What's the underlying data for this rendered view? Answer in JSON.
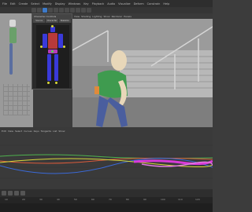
{
  "app": {
    "menu": [
      "File",
      "Edit",
      "Create",
      "Select",
      "Modify",
      "Display",
      "Windows",
      "Key",
      "Playback",
      "Audio",
      "Visualize",
      "Deform",
      "Constrain",
      "Help"
    ],
    "accent": "#3d7ac9"
  },
  "hik_panel": {
    "title": "Character Controls",
    "tabs": [
      "Source",
      "Character",
      "Skeleton",
      "Definition"
    ]
  },
  "main_viewport": {
    "menu": [
      "View",
      "Shading",
      "Lighting",
      "Show",
      "Renderer",
      "Panels"
    ]
  },
  "timeline": {
    "menu": [
      "Edit",
      "View",
      "Select",
      "Curves",
      "Keys",
      "Tangents",
      "List",
      "Show"
    ],
    "ruler_labels": [
      "10",
      "20",
      "30",
      "40",
      "50",
      "60",
      "70",
      "80",
      "90",
      "100",
      "110",
      "120"
    ],
    "curve_colors": [
      "#d93ad9",
      "#4fb34f",
      "#d95a3a",
      "#3a6ad9",
      "#d9d93a"
    ]
  }
}
